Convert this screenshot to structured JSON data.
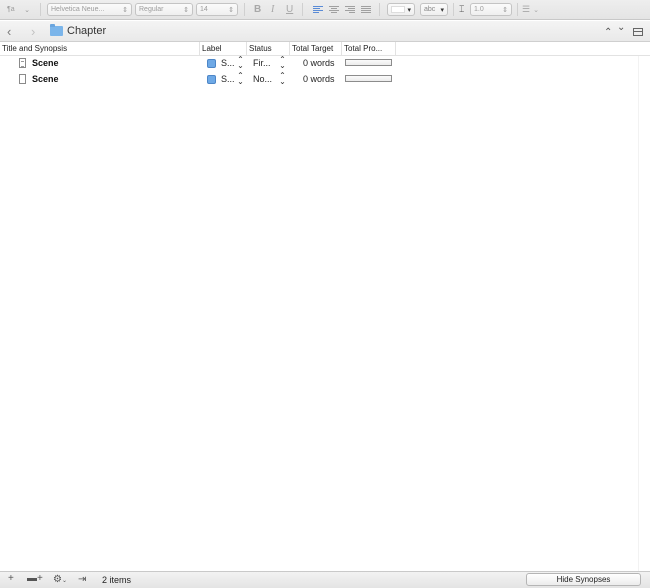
{
  "format_bar": {
    "paragraph_symbol": "¶a",
    "font_family": "Helvetica Neue...",
    "font_style": "Regular",
    "font_size": "14",
    "bold": "B",
    "italic": "I",
    "underline": "U",
    "highlight_sample": "abc",
    "line_spacing": "1.0"
  },
  "path_bar": {
    "title": "Chapter",
    "back_glyph": "‹",
    "forward_glyph": "›",
    "up_glyph": "⌃",
    "down_glyph": "⌄"
  },
  "outline": {
    "columns": [
      {
        "label": "Title and Synopsis"
      },
      {
        "label": "Label"
      },
      {
        "label": "Status"
      },
      {
        "label": "Total Target"
      },
      {
        "label": "Total Pro..."
      }
    ],
    "rows": [
      {
        "title": "Scene",
        "label": "S...",
        "status": "Fir...",
        "target": "0 words",
        "progress": 0,
        "has_text": true
      },
      {
        "title": "Scene",
        "label": "S...",
        "status": "No...",
        "target": "0 words",
        "progress": 0,
        "has_text": false
      }
    ]
  },
  "bottom_bar": {
    "add": "+",
    "item_count": "2 items",
    "hide_synopses": "Hide Synopses"
  },
  "colors": {
    "label_blue": "#6ea9e6",
    "folder_blue": "#7bb5ea"
  },
  "icons": [
    "paragraph-style-icon",
    "align-left-icon",
    "align-center-icon",
    "align-right-icon",
    "justify-icon",
    "line-spacing-icon",
    "list-icon",
    "folder-icon",
    "document-icon",
    "split-view-icon",
    "add-icon",
    "add-folder-icon",
    "gear-icon",
    "export-icon"
  ]
}
